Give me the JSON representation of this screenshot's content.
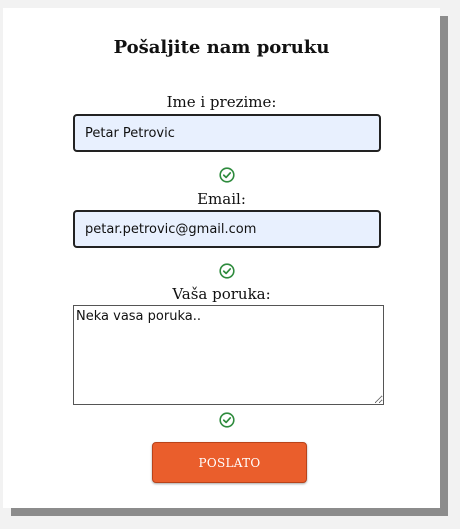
{
  "form": {
    "title": "Pošaljite nam poruku",
    "name_label": "Ime i prezime:",
    "name_value": "Petar Petrovic",
    "email_label": "Email:",
    "email_value": "petar.petrovic@gmail.com",
    "message_label": "Vaša poruka:",
    "message_value": "Neka vasa poruka..",
    "submit_label": "POSLATO",
    "valid_icon": "check-circle-icon",
    "colors": {
      "accent": "#ea5e2c",
      "valid": "#2e8b3d",
      "input_autofill_bg": "#e8f0fe"
    }
  }
}
